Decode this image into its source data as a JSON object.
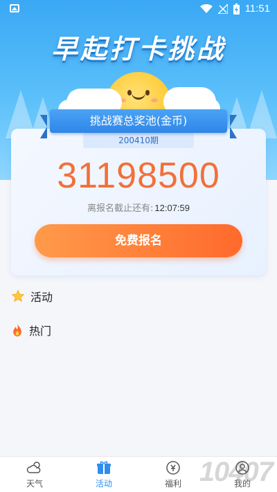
{
  "status_bar": {
    "time": "11:51"
  },
  "header": {
    "title": "早起打卡挑战"
  },
  "prize_card": {
    "ribbon_label": "挑战赛总奖池(金币)",
    "period": "200410期",
    "pool_amount": "31198500",
    "deadline_label": "离报名截止还有:",
    "countdown": "12:07:59",
    "signup_button": "免费报名"
  },
  "sections": [
    {
      "label": "活动",
      "icon": "star-icon"
    },
    {
      "label": "热门",
      "icon": "flame-icon"
    }
  ],
  "bottom_nav": [
    {
      "label": "天气",
      "icon": "weather-icon",
      "active": false
    },
    {
      "label": "活动",
      "icon": "gift-icon",
      "active": true
    },
    {
      "label": "福利",
      "icon": "coin-icon",
      "active": false
    },
    {
      "label": "我的",
      "icon": "user-icon",
      "active": false
    }
  ],
  "watermark": "10407",
  "colors": {
    "accent": "#2f8df0",
    "pool": "#f2703a",
    "button": "#ff6a2c"
  }
}
